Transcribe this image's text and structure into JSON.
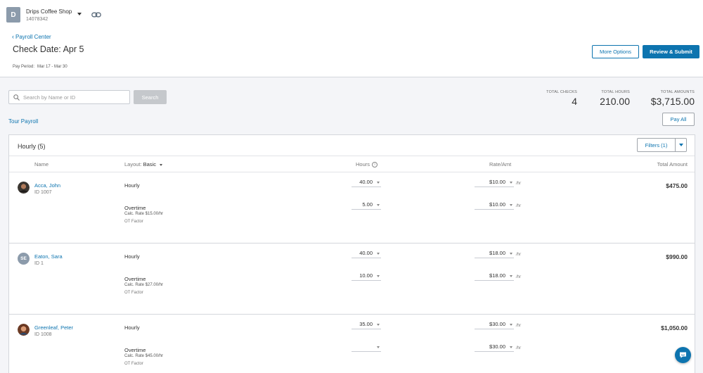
{
  "company": {
    "initial": "D",
    "name": "Drips Coffee Shop",
    "id": "14078342"
  },
  "nav": {
    "back_label": "Payroll Center"
  },
  "page": {
    "title": "Check Date: Apr 5",
    "period_label": "Pay Period:",
    "period_value": "Mar 17 - Mar 30"
  },
  "actions": {
    "more_options": "More Options",
    "review_submit": "Review & Submit",
    "pay_all": "Pay All",
    "tour": "Tour Payroll"
  },
  "search": {
    "placeholder": "Search by Name or ID",
    "button": "Search"
  },
  "totals": {
    "checks_label": "TOTAL CHECKS",
    "checks": "4",
    "hours_label": "TOTAL HOURS",
    "hours": "210.00",
    "amounts_label": "TOTAL AMOUNTS",
    "amounts": "$3,715.00"
  },
  "section": {
    "title": "Hourly (5)",
    "filters": "Filters (1)"
  },
  "columns": {
    "name": "Name",
    "layout_label": "Layout:",
    "layout_value": "Basic",
    "hours": "Hours",
    "rate": "Rate/Amt",
    "total": "Total Amount"
  },
  "employees": [
    {
      "name": "Acca, John",
      "id": "ID 1007",
      "avatar": "photo",
      "regular_label": "Hourly",
      "regular_hours": "40.00",
      "regular_rate": "$10.00",
      "ot_label": "Overtime",
      "ot_calc": "Calc. Rate $15.00/hr",
      "ot_factor": "OT Factor",
      "ot_hours": "5.00",
      "ot_rate": "$10.00",
      "unit": "/hr",
      "total": "$475.00"
    },
    {
      "name": "Eaton, Sara",
      "id": "ID 1",
      "avatar": "SE",
      "regular_label": "Hourly",
      "regular_hours": "40.00",
      "regular_rate": "$18.00",
      "ot_label": "Overtime",
      "ot_calc": "Calc. Rate $27.00/hr",
      "ot_factor": "OT Factor",
      "ot_hours": "10.00",
      "ot_rate": "$18.00",
      "unit": "/hr",
      "total": "$990.00"
    },
    {
      "name": "Greenleaf, Peter",
      "id": "ID 1008",
      "avatar": "photo",
      "regular_label": "Hourly",
      "regular_hours": "35.00",
      "regular_rate": "$30.00",
      "ot_label": "Overtime",
      "ot_calc": "Calc. Rate $45.00/hr",
      "ot_factor": "OT Factor",
      "ot_hours": "",
      "ot_rate": "$30.00",
      "unit": "/hr",
      "total": "$1,050.00"
    }
  ],
  "colors": {
    "accent": "#0d74af",
    "avatar_bg": "#8c9bab"
  }
}
